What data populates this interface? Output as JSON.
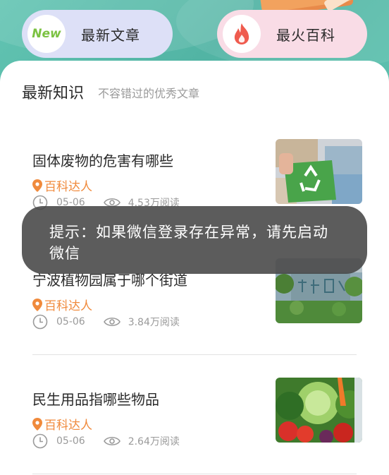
{
  "tabs": {
    "new": {
      "icon_text": "New",
      "label": "最新文章"
    },
    "hot": {
      "label": "最火百科"
    }
  },
  "section": {
    "title": "最新知识",
    "subtitle": "不容错过的优秀文章"
  },
  "articles": [
    {
      "title": "固体废物的危害有哪些",
      "author": "百科达人",
      "date": "05-06",
      "reads": "4.53万阅读",
      "thumb": "recycling-image"
    },
    {
      "title": "宁波植物园属于哪个街道",
      "author": "百科达人",
      "date": "05-06",
      "reads": "3.84万阅读",
      "thumb": "botanical-garden-image"
    },
    {
      "title": "民生用品指哪些物品",
      "author": "百科达人",
      "date": "05-06",
      "reads": "2.64万阅读",
      "thumb": "vegetables-image"
    }
  ],
  "toast": {
    "text": "提示：如果微信登录存在异常，请先启动微信"
  },
  "colors": {
    "accent_orange": "#f08a3c",
    "header_teal": "#5cc0ae",
    "toast_bg": "#464646"
  }
}
